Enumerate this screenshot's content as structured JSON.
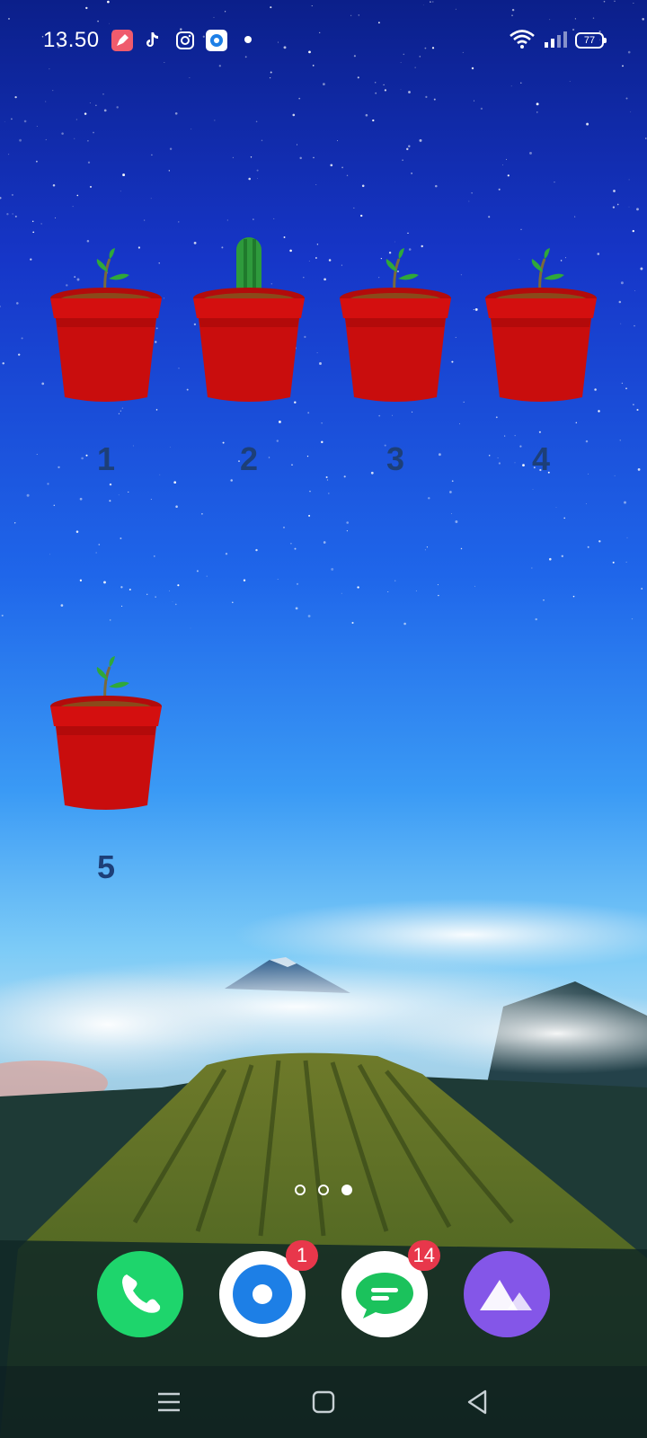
{
  "status_bar": {
    "time": "13.50",
    "notification_icons": [
      "pen-app-icon",
      "tiktok-icon",
      "instagram-icon",
      "browser-app-icon"
    ],
    "wifi_icon": "wifi-icon",
    "signal_icon": "signal-icon",
    "battery_level": "77"
  },
  "widgets": [
    {
      "label": "1",
      "plant": "sprout"
    },
    {
      "label": "2",
      "plant": "cactus"
    },
    {
      "label": "3",
      "plant": "sprout"
    },
    {
      "label": "4",
      "plant": "sprout"
    },
    {
      "label": "5",
      "plant": "sprout"
    }
  ],
  "page_indicator": {
    "pages": 3,
    "active_page": 3
  },
  "dock": [
    {
      "name": "phone-app",
      "icon": "phone-icon",
      "badge": ""
    },
    {
      "name": "browser-app",
      "icon": "browser-icon",
      "badge": "1"
    },
    {
      "name": "messages-app",
      "icon": "messages-icon",
      "badge": "14"
    },
    {
      "name": "photos-app",
      "icon": "photos-icon",
      "badge": ""
    }
  ],
  "nav_bar": {
    "buttons": [
      "menu-icon",
      "home-icon",
      "back-icon"
    ]
  },
  "colors": {
    "pot": "#d40f0f",
    "badge": "#e8374b",
    "phone": "#1ed56c",
    "photos": "#8456e8",
    "number_text": "#1d3f78"
  }
}
